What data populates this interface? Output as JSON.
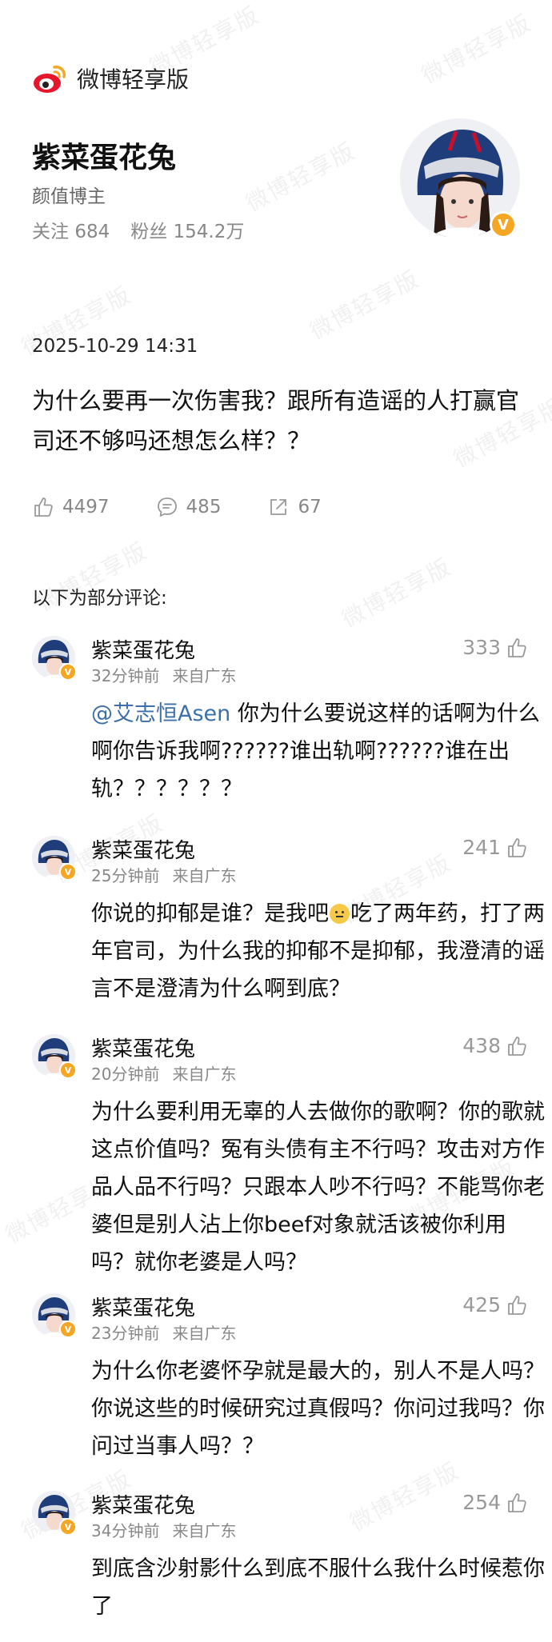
{
  "app": {
    "name": "微博轻享版",
    "watermark": "微博轻享版"
  },
  "profile": {
    "name": "紫菜蛋花兔",
    "title": "颜值博主",
    "follow_label": "关注",
    "follow_count": "684",
    "fans_label": "粉丝",
    "fans_count": "154.2万",
    "verify_mark": "V"
  },
  "post": {
    "time": "2025-10-29 14:31",
    "text": "为什么要再一次伤害我？跟所有造谣的人打赢官司还不够吗还想怎么样？？",
    "likes": "4497",
    "comments": "485",
    "reposts": "67"
  },
  "comments_section": {
    "title": "以下为部分评论:",
    "items": [
      {
        "name": "紫菜蛋花兔",
        "time": "32分钟前",
        "from": "来自广东",
        "likes": "333",
        "mention": "@艾志恒Asen",
        "text": " 你为什么要说这样的话啊为什么啊你告诉我啊??????谁出轨啊??????谁在出轨？？？？？？"
      },
      {
        "name": "紫菜蛋花兔",
        "time": "25分钟前",
        "from": "来自广东",
        "likes": "241",
        "text_before": "你说的抑郁是谁？是我吧",
        "text_after": "吃了两年药，打了两年官司，为什么我的抑郁不是抑郁，我澄清的谣言不是澄清为什么啊到底？"
      },
      {
        "name": "紫菜蛋花兔",
        "time": "20分钟前",
        "from": "来自广东",
        "likes": "438",
        "text": "为什么要利用无辜的人去做你的歌啊？你的歌就这点价值吗？冤有头债有主不行吗？攻击对方作品人品不行吗？只跟本人吵不行吗？不能骂你老婆但是别人沾上你beef对象就活该被你利用吗？就你老婆是人吗？"
      },
      {
        "name": "紫菜蛋花兔",
        "time": "23分钟前",
        "from": "来自广东",
        "likes": "425",
        "text": "为什么你老婆怀孕就是最大的，别人不是人吗？你说这些的时候研究过真假吗？你问过我吗？你问过当事人吗？？"
      },
      {
        "name": "紫菜蛋花兔",
        "time": "34分钟前",
        "from": "来自广东",
        "likes": "254",
        "text": "到底含沙射影什么到底不服什么我什么时候惹你了"
      }
    ]
  },
  "colors": {
    "accent_badge": "#f5a623",
    "mention": "#3d6fa8",
    "weibo_red": "#e6162d"
  },
  "icons": {
    "logo": "weibo-logo",
    "like": "thumb-up-icon",
    "comment": "comment-icon",
    "repost": "repost-icon"
  }
}
